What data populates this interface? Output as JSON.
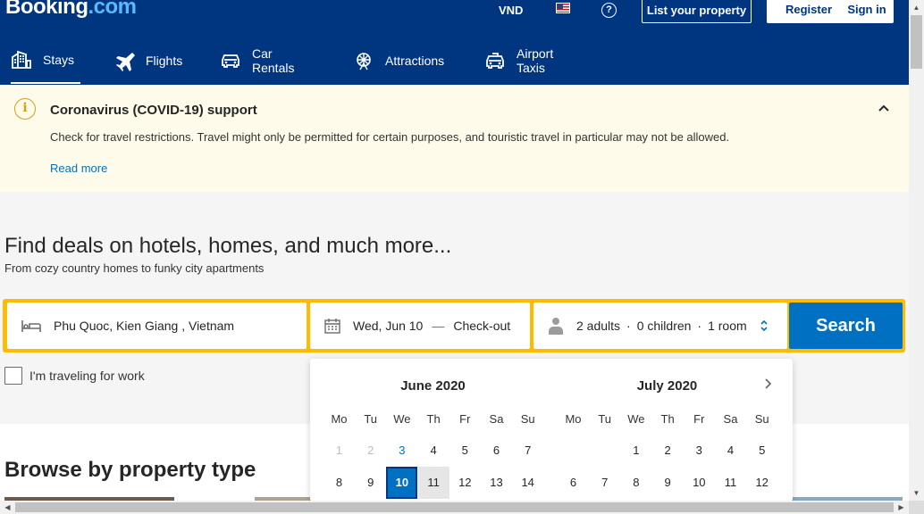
{
  "header": {
    "logo_main": "Booking",
    "logo_tld": ".com",
    "currency": "VND",
    "list_property": "List your property",
    "register": "Register",
    "sign_in": "Sign in"
  },
  "nav": [
    {
      "label": "Stays",
      "icon": "bed-building-icon",
      "active": true
    },
    {
      "label": "Flights",
      "icon": "plane-icon",
      "active": false
    },
    {
      "label": "Car Rentals",
      "icon": "car-icon",
      "active": false
    },
    {
      "label": "Attractions",
      "icon": "ferris-wheel-icon",
      "active": false
    },
    {
      "label": "Airport Taxis",
      "icon": "taxi-icon",
      "active": false
    }
  ],
  "covid": {
    "title": "Coronavirus (COVID-19) support",
    "message": "Check for travel restrictions. Travel might only be permitted for certain purposes, and touristic travel in particular may not be allowed.",
    "read_more": "Read more"
  },
  "hero": {
    "title": "Find deals on hotels, homes, and much more...",
    "subtitle": "From cozy country homes to funky city apartments"
  },
  "search": {
    "destination": "Phu Quoc, Kien Giang , Vietnam",
    "checkin": "Wed, Jun 10",
    "dash": "—",
    "checkout": "Check-out",
    "adults": "2 adults",
    "children": "0 children",
    "rooms": "1 room",
    "sep": "·",
    "button": "Search"
  },
  "work_travel": "I'm traveling for work",
  "browse_title": "Browse by property type",
  "calendar": {
    "weekdays": [
      "Mo",
      "Tu",
      "We",
      "Th",
      "Fr",
      "Sa",
      "Su"
    ],
    "months": [
      {
        "title": "June 2020",
        "rows": [
          [
            "1",
            "2",
            "3",
            "4",
            "5",
            "6",
            "7"
          ],
          [
            "8",
            "9",
            "10",
            "11",
            "12",
            "13",
            "14"
          ]
        ]
      },
      {
        "title": "July 2020",
        "rows": [
          [
            "",
            "",
            "1",
            "2",
            "3",
            "4",
            "5"
          ],
          [
            "6",
            "7",
            "8",
            "9",
            "10",
            "11",
            "12"
          ]
        ]
      }
    ],
    "selected_day": "10",
    "today": "3"
  },
  "colors": {
    "brand_blue": "#003580",
    "accent_blue": "#0071c2",
    "search_yellow": "#febb02",
    "banner_bg": "#fffbea"
  }
}
